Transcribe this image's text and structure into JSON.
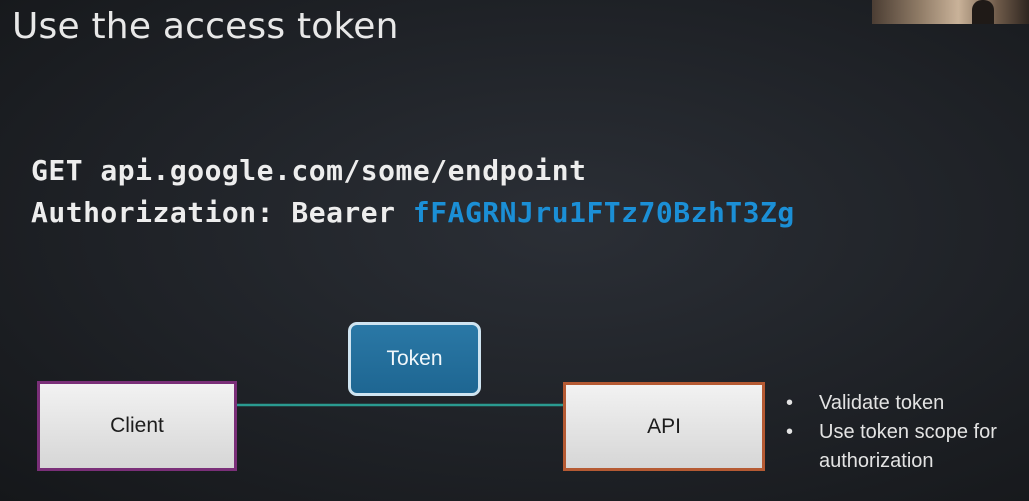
{
  "slide": {
    "title": "Use the access token"
  },
  "code": {
    "line1": "GET api.google.com/some/endpoint",
    "line2_prefix": "Authorization: Bearer ",
    "line2_token": "fFAGRNJru1FTz70BzhT3Zg"
  },
  "diagram": {
    "client_label": "Client",
    "api_label": "API",
    "token_label": "Token",
    "arrow_color": "#2a9a90",
    "token_box_color": "#2a78a6",
    "client_border_color": "#7a2f78",
    "api_border_color": "#b55a33"
  },
  "bullets": {
    "marker": "•",
    "items": [
      "Validate token",
      "Use token scope for authorization"
    ]
  },
  "colors": {
    "token_text": "#1b8fd6",
    "background": "#1f2227"
  }
}
